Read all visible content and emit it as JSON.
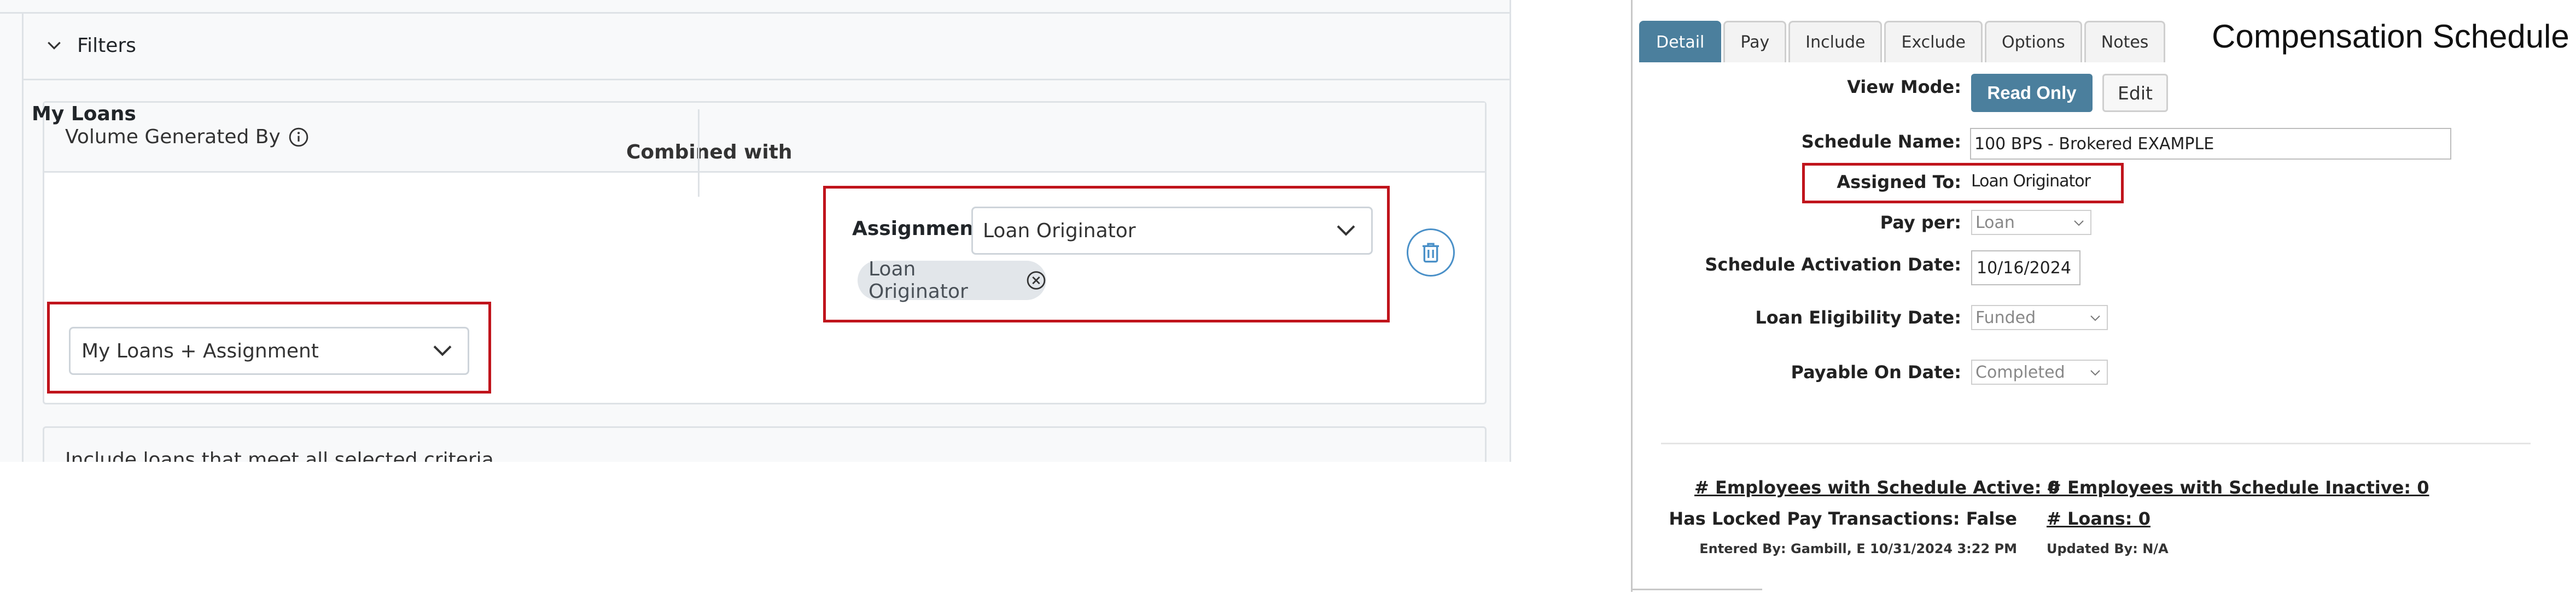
{
  "left": {
    "filters_title": "Filters",
    "volume_title": "Volume Generated By",
    "my_loans_label": "My Loans",
    "combined_with": "Combined with",
    "assignment_label": "Assignment",
    "assignment_value": "Loan Originator",
    "tag_label": "Loan Originator",
    "loans_select_value": "My Loans + Assignment",
    "include_text": "Include loans that meet all selected criteria"
  },
  "right": {
    "title": "Compensation Schedule",
    "tabs": [
      "Detail",
      "Pay",
      "Include",
      "Exclude",
      "Options",
      "Notes"
    ],
    "view_mode_label": "View Mode:",
    "read_only_label": "Read Only",
    "edit_label": "Edit",
    "schedule_name_label": "Schedule Name:",
    "schedule_name_value": "100 BPS - Brokered EXAMPLE",
    "assigned_to_label": "Assigned To:",
    "assigned_to_value": "Loan Originator",
    "pay_per_label": "Pay per:",
    "pay_per_value": "Loan",
    "activation_label": "Schedule Activation Date:",
    "activation_value": "10/16/2024",
    "eligibility_label": "Loan Eligibility Date:",
    "eligibility_value": "Funded",
    "payable_label": "Payable On Date:",
    "payable_value": "Completed",
    "employees_active": "# Employees with Schedule Active: 0",
    "employees_inactive": "# Employees with Schedule Inactive: 0",
    "locked_tx": "Has Locked Pay Transactions: False",
    "num_loans": "# Loans: 0",
    "entered_by": "Entered By: Gambill, E 10/31/2024 3:22 PM",
    "updated_by": "Updated By: N/A"
  },
  "colors": {
    "highlight_red": "#c0141c",
    "tab_active": "#4b7f9d",
    "trash_blue": "#4a90c8"
  }
}
